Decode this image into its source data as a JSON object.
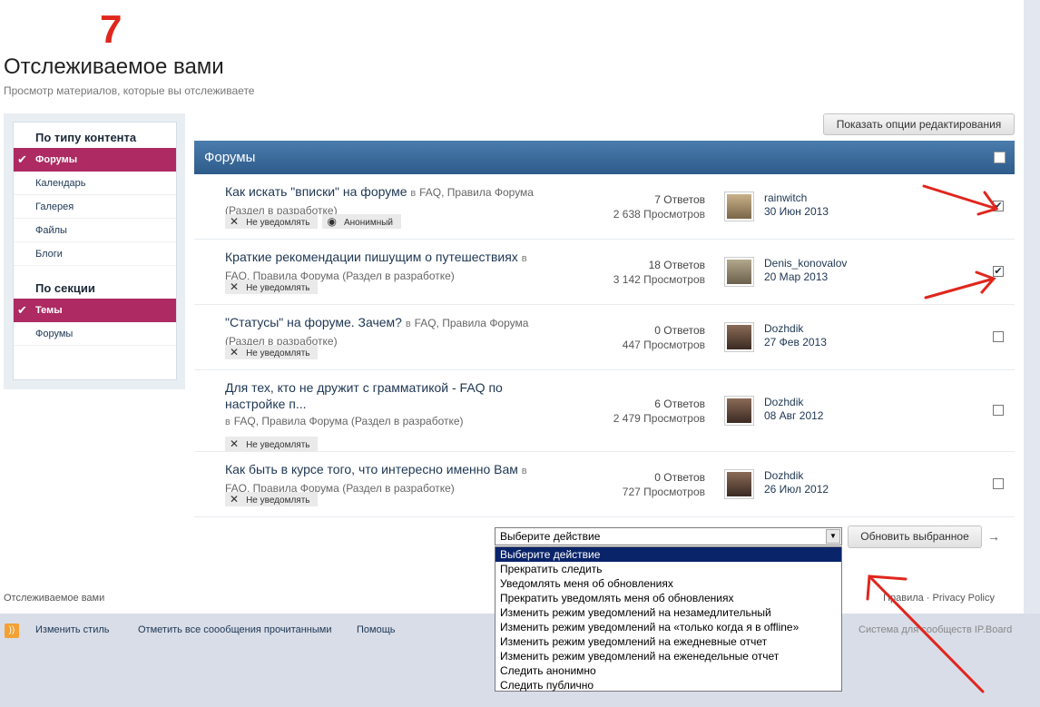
{
  "annotation_number": "7",
  "page_title": "Отслеживаемое вами",
  "page_subtitle": "Просмотр материалов, которые вы отслеживаете",
  "edit_options_button": "Показать опции редактирования",
  "sidebar": {
    "content_type_heading": "По типу контента",
    "content_types": [
      {
        "label": "Форумы",
        "active": true
      },
      {
        "label": "Календарь",
        "active": false
      },
      {
        "label": "Галерея",
        "active": false
      },
      {
        "label": "Файлы",
        "active": false
      },
      {
        "label": "Блоги",
        "active": false
      }
    ],
    "section_heading": "По секции",
    "sections": [
      {
        "label": "Темы",
        "active": true
      },
      {
        "label": "Форумы",
        "active": false
      }
    ]
  },
  "forum_section_label": "Форумы",
  "topics": [
    {
      "title": "Как искать \"вписки\" на форуме",
      "in_word": "в",
      "location_inline": "FAQ, Правила Форума",
      "location_line2": "(Раздел в разработке)",
      "tags": [
        "Не уведомлять",
        "Анонимный"
      ],
      "replies": "7 Ответов",
      "views": "2 638 Просмотров",
      "user": "rainwitch",
      "date": "30 Июн 2013",
      "checked": true
    },
    {
      "title": "Краткие рекомендации пишущим о путешествиях",
      "in_word": "в",
      "location_inline": "",
      "location_line2": "FAQ, Правила Форума (Раздел в разработке)",
      "tags": [
        "Не уведомлять"
      ],
      "replies": "18 Ответов",
      "views": "3 142 Просмотров",
      "user": "Denis_konovalov",
      "date": "20 Мар 2013",
      "checked": true
    },
    {
      "title": "\"Статусы\" на форуме. Зачем?",
      "in_word": "в",
      "location_inline": "FAQ, Правила Форума",
      "location_line2": "(Раздел в разработке)",
      "tags": [
        "Не уведомлять"
      ],
      "replies": "0 Ответов",
      "views": "447 Просмотров",
      "user": "Dozhdik",
      "date": "27 Фев 2013",
      "checked": false
    },
    {
      "title": "Для тех, кто не дружит с грамматикой - FAQ по настройке п...",
      "in_word": "в",
      "location_inline": "",
      "location_line2": "FAQ, Правила Форума (Раздел в разработке)",
      "tags": [
        "Не уведомлять"
      ],
      "replies": "6 Ответов",
      "views": "2 479 Просмотров",
      "user": "Dozhdik",
      "date": "08 Авг 2012",
      "checked": false
    },
    {
      "title": "Как быть в курсе того, что интересно именно Вам",
      "in_word": "в",
      "location_inline": "",
      "location_line2": "FAQ, Правила Форума (Раздел в разработке)",
      "tags": [
        "Не уведомлять"
      ],
      "replies": "0 Ответов",
      "views": "727 Просмотров",
      "user": "Dozhdik",
      "date": "26 Июл 2012",
      "checked": false
    }
  ],
  "action_select": {
    "value": "Выберите действие",
    "options": [
      "Выберите действие",
      "Прекратить следить",
      "Уведомлять меня об обновлениях",
      "Прекратить уведомлять меня об обновлениях",
      "Изменить режим уведомлений на незамедлительный",
      "Изменить режим уведомлений на «только когда я в offline»",
      "Изменить режим уведомлений на ежедневные отчет",
      "Изменить режим уведомлений на еженедельные отчет",
      "Следить анонимно",
      "Следить публично"
    ]
  },
  "update_button": "Обновить выбранное",
  "footer": {
    "breadcrumb": "Отслеживаемое вами",
    "rules": "Правила",
    "separator": " · ",
    "privacy": "Privacy Policy"
  },
  "bottom_links": {
    "change_style": "Изменить стиль",
    "mark_read": "Отметить все соообщения прочитанными",
    "help": "Помощь",
    "powered": "Система для сообществ IP.Board"
  }
}
